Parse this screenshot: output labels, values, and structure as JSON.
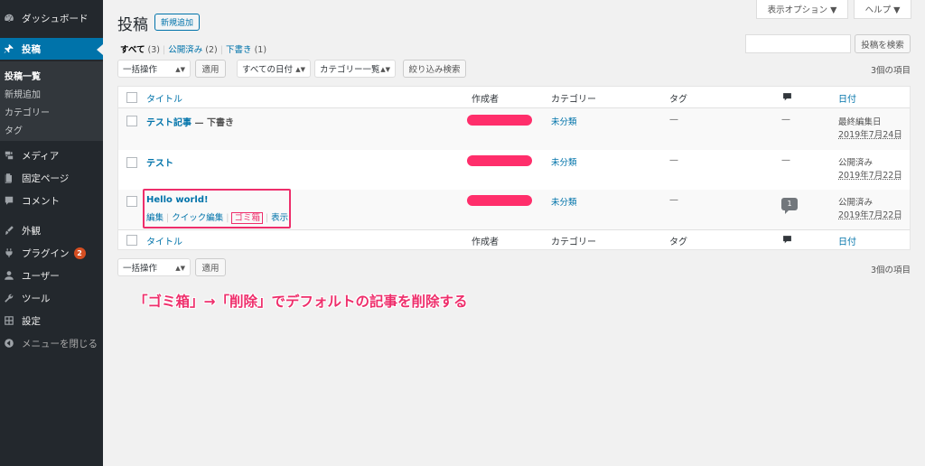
{
  "colors": {
    "sidebar_bg": "#23282d",
    "active": "#0073aa",
    "link": "#0073aa",
    "highlight": "#ee2e6b",
    "author_redaction": "#ff2e6b"
  },
  "sidebar": {
    "items": [
      {
        "label": "ダッシュボード",
        "icon": "dashboard-icon"
      },
      {
        "label": "投稿",
        "icon": "pin-icon",
        "active": true
      },
      {
        "label": "メディア",
        "icon": "media-icon"
      },
      {
        "label": "固定ページ",
        "icon": "page-icon"
      },
      {
        "label": "コメント",
        "icon": "comment-icon"
      },
      {
        "label": "外観",
        "icon": "appearance-icon"
      },
      {
        "label": "プラグイン",
        "icon": "plugin-icon",
        "badge": "2"
      },
      {
        "label": "ユーザー",
        "icon": "user-icon"
      },
      {
        "label": "ツール",
        "icon": "wrench-icon"
      },
      {
        "label": "設定",
        "icon": "settings-icon"
      },
      {
        "label": "メニューを閉じる",
        "icon": "collapse-icon"
      }
    ],
    "submenu": [
      "投稿一覧",
      "新規追加",
      "カテゴリー",
      "タグ"
    ]
  },
  "header": {
    "title": "投稿",
    "add_new": "新規追加",
    "screen_options": "表示オプション ▼",
    "help": "ヘルプ ▼"
  },
  "filters": {
    "all": "すべて",
    "all_count": "(3)",
    "published": "公開済み",
    "published_count": "(2)",
    "draft": "下書き",
    "draft_count": "(1)"
  },
  "search": {
    "button": "投稿を検索",
    "value": ""
  },
  "toolbar": {
    "bulk_action": "一括操作",
    "apply": "適用",
    "all_dates": "すべての日付",
    "category": "カテゴリー一覧",
    "filter": "絞り込み検索",
    "item_count": "3個の項目"
  },
  "table": {
    "columns": {
      "title": "タイトル",
      "author": "作成者",
      "category": "カテゴリー",
      "tag": "タグ",
      "comments_icon": "comment-icon",
      "date": "日付"
    },
    "rows": [
      {
        "title": "テスト記事",
        "state": " — 下書き",
        "category": "未分類",
        "tag": "—",
        "comments": "—",
        "date_status": "最終編集日",
        "date": "2019年7月24日"
      },
      {
        "title": "テスト",
        "state": "",
        "category": "未分類",
        "tag": "—",
        "comments": "—",
        "date_status": "公開済み",
        "date": "2019年7月22日"
      },
      {
        "title": "Hello world!",
        "state": "",
        "category": "未分類",
        "tag": "—",
        "comments": "1",
        "date_status": "公開済み",
        "date": "2019年7月22日",
        "actions": {
          "edit": "編集",
          "quick_edit": "クイック編集",
          "trash": "ゴミ箱",
          "view": "表示"
        }
      }
    ]
  },
  "caption": "「ゴミ箱」→「削除」でデフォルトの記事を削除する"
}
